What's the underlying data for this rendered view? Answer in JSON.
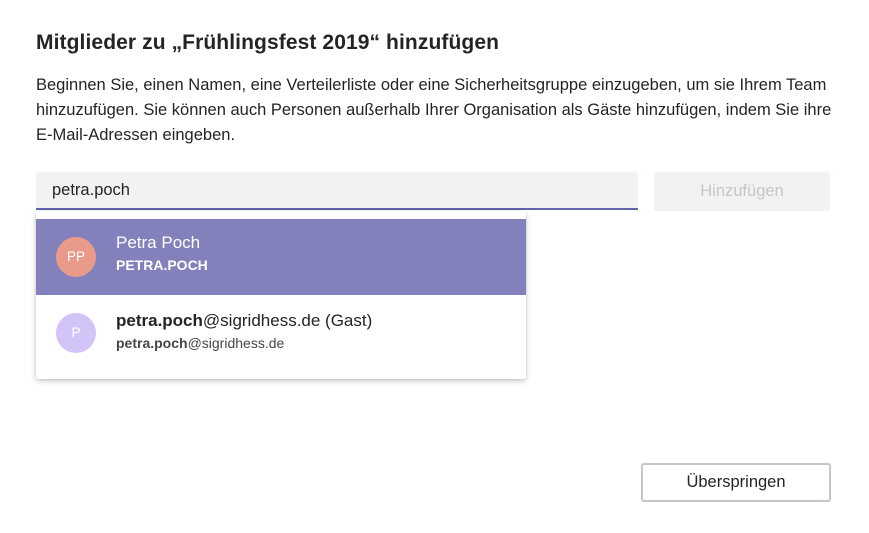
{
  "dialog": {
    "title": "Mitglieder zu „Frühlingsfest 2019“ hinzufügen",
    "description": "Beginnen Sie, einen Namen, eine Verteilerliste oder eine Sicherheitsgruppe einzugeben, um sie Ihrem Team hinzuzufügen. Sie können auch Personen außerhalb Ihrer Organisation als Gäste hinzufügen, indem Sie ihre E-Mail-Adressen eingeben."
  },
  "search": {
    "value": "petra.poch",
    "placeholder": ""
  },
  "add_button": {
    "label": "Hinzufügen",
    "enabled": false
  },
  "suggestions": [
    {
      "avatar_initials": "PP",
      "avatar_color": "#e99a8a",
      "name": "Petra Poch",
      "subtitle": "PETRA.POCH",
      "highlighted": true
    },
    {
      "avatar_initials": "P",
      "avatar_color": "#d3c4f7",
      "name_bold": "petra.poch",
      "name_rest": "@sigridhess.de (Gast)",
      "subtitle_bold": "petra.poch",
      "subtitle_rest": "@sigridhess.de",
      "highlighted": false
    }
  ],
  "skip_button": {
    "label": "Überspringen"
  },
  "colors": {
    "accent": "#6264a7",
    "highlight": "#8381bb",
    "input_bg": "#f3f2f1",
    "disabled_text": "#c8c6c4"
  }
}
